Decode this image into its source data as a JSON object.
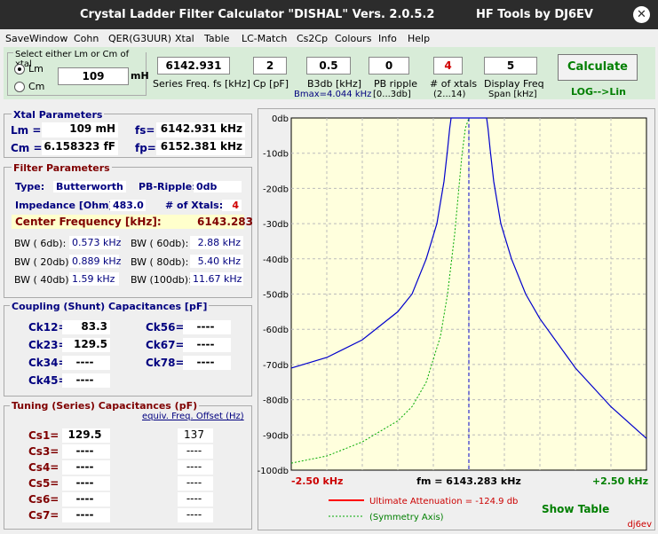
{
  "window": {
    "title": "Crystal Ladder Filter Calculator  \"DISHAL\"  Vers. 2.0.5.2",
    "brand": "HF Tools by DJ6EV",
    "close": "✕"
  },
  "menu": [
    "SaveWindow",
    "Cohn",
    "QER(G3UUR)",
    "Xtal",
    "Table",
    "LC-Match",
    "Cs2Cp",
    "Colours",
    "Info",
    "Help"
  ],
  "lmcm": {
    "title": "Select either Lm or Cm of xtal",
    "lm_label": "Lm",
    "cm_label": "Cm",
    "value": "109",
    "unit": "mH"
  },
  "inputs": {
    "fs": {
      "value": "6142.931",
      "label": "Series Freq. fs [kHz]"
    },
    "cp": {
      "value": "2",
      "label": "Cp [pF]"
    },
    "b3db": {
      "value": "0.5",
      "label": "B3db [kHz]",
      "sub": "Bmax=4.044 kHz"
    },
    "ripple": {
      "value": "0",
      "label": "PB ripple",
      "sub": "[0...3db]"
    },
    "xtals": {
      "value": "4",
      "label": "# of xtals",
      "sub": "(2...14)"
    },
    "span": {
      "value": "5",
      "label": "Display Freq",
      "sub": "Span [kHz]"
    }
  },
  "calculate": {
    "label": "Calculate",
    "toggle": "LOG-->Lin"
  },
  "xtal_params": {
    "title": "Xtal Parameters",
    "lm_label": "Lm =",
    "lm_value": "109 mH",
    "fs_label": "fs=",
    "fs_value": "6142.931 kHz",
    "cm_label": "Cm =",
    "cm_value": "6.158323  fF",
    "fp_label": "fp=",
    "fp_value": "6152.381 kHz"
  },
  "filter_params": {
    "title": "Filter Parameters",
    "type_label": "Type:",
    "type_value": "Butterworth",
    "pb_label": "PB-Ripple:",
    "pb_value": "0db",
    "imp_label": "Impedance [Ohm]:",
    "imp_value": "483.0",
    "nx_label": "# of Xtals:",
    "nx_value": "4",
    "cf_label": "Center Frequency [kHz]:",
    "cf_value": "6143.283",
    "bw": [
      {
        "label": "BW (  6db):",
        "value": "0.573 kHz",
        "label2": "BW ( 60db):",
        "value2": "2.88 kHz"
      },
      {
        "label": "BW ( 20db):",
        "value": "0.889 kHz",
        "label2": "BW ( 80db):",
        "value2": "5.40 kHz"
      },
      {
        "label": "BW ( 40db):",
        "value": "1.59 kHz",
        "label2": "BW (100db):",
        "value2": "11.67 kHz"
      }
    ]
  },
  "coupling": {
    "title": "Coupling (Shunt) Capacitances [pF]",
    "left": [
      {
        "label": "Ck12=",
        "value": "83.3"
      },
      {
        "label": "Ck23=",
        "value": "129.5"
      },
      {
        "label": "Ck34=",
        "value": "----"
      },
      {
        "label": "Ck45=",
        "value": "----"
      }
    ],
    "right": [
      {
        "label": "Ck56=",
        "value": "----"
      },
      {
        "label": "Ck67=",
        "value": "----"
      },
      {
        "label": "Ck78=",
        "value": "----"
      }
    ]
  },
  "tuning": {
    "title": "Tuning (Series) Capacitances (pF)",
    "link": "equiv. Freq. Offset (Hz)",
    "rows": [
      {
        "label": "Cs1=",
        "value": "129.5",
        "offset": "137"
      },
      {
        "label": "Cs3=",
        "value": "----",
        "offset": "----"
      },
      {
        "label": "Cs4=",
        "value": "----",
        "offset": "----"
      },
      {
        "label": "Cs5=",
        "value": "----",
        "offset": "----"
      },
      {
        "label": "Cs6=",
        "value": "----",
        "offset": "----"
      },
      {
        "label": "Cs7=",
        "value": "----",
        "offset": "----"
      }
    ]
  },
  "chart_data": {
    "type": "line",
    "y_ticks": [
      "0db",
      "-10db",
      "-20db",
      "-30db",
      "-40db",
      "-50db",
      "-60db",
      "-70db",
      "-80db",
      "-90db",
      "-100db"
    ],
    "ylim": [
      -100,
      0
    ],
    "xlim": [
      -2.5,
      2.5
    ],
    "x_left_label": "-2.50 kHz",
    "x_center_label": "fm = 6143.283 kHz",
    "x_right_label": "+2.50 kHz",
    "series": [
      {
        "color": "#0000cc",
        "x": [
          -2.5,
          -2.0,
          -1.5,
          -1.0,
          -0.8,
          -0.6,
          -0.45,
          -0.35,
          -0.3,
          -0.27,
          -0.25,
          0.0,
          0.25,
          0.27,
          0.3,
          0.35,
          0.45,
          0.6,
          0.8,
          1.0,
          1.5,
          2.0,
          2.5
        ],
        "y": [
          -71,
          -68,
          -63,
          -55,
          -50,
          -40,
          -30,
          -18,
          -9,
          -3,
          0,
          0,
          0,
          -3,
          -9,
          -18,
          -30,
          -40,
          -50,
          -57,
          -71,
          -82,
          -91
        ]
      },
      {
        "color": "#00aa00",
        "dashed": true,
        "x": [
          -2.5,
          -2.0,
          -1.5,
          -1.0,
          -0.8,
          -0.6,
          -0.4,
          -0.3,
          -0.2,
          -0.15,
          -0.1,
          -0.05,
          0.0
        ],
        "y": [
          -98,
          -96,
          -92,
          -86,
          -82,
          -75,
          -62,
          -50,
          -33,
          -22,
          -11,
          -3,
          0
        ]
      }
    ],
    "legend": [
      {
        "label": "Ultimate Attenuation =   -124.9 db",
        "color": "#ff0000"
      },
      {
        "label": "(Symmetry Axis)",
        "color": "#00aa00"
      }
    ],
    "show_table": "Show Table",
    "watermark": "dj6ev"
  }
}
